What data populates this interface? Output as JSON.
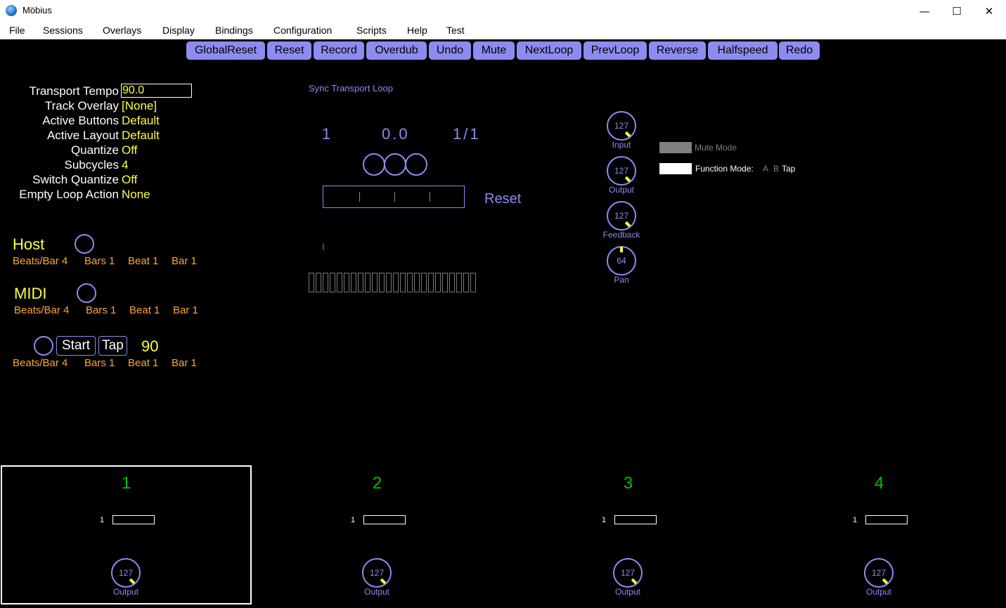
{
  "window": {
    "title": "Möbius",
    "minimize": "—",
    "maximize": "☐",
    "close": "✕"
  },
  "menu": [
    "File",
    "Sessions",
    "Overlays",
    "Display",
    "Bindings",
    "Configuration",
    "Scripts",
    "Help",
    "Test"
  ],
  "buttons": [
    "GlobalReset",
    "Reset",
    "Record",
    "Overdub",
    "Undo",
    "Mute",
    "NextLoop",
    "PrevLoop",
    "Reverse",
    "Halfspeed",
    "Redo"
  ],
  "params": {
    "tempo_label": "Transport Tempo",
    "tempo_value": "90.0",
    "items": [
      {
        "label": "Track Overlay",
        "value": "[None]"
      },
      {
        "label": "Active Buttons",
        "value": "Default"
      },
      {
        "label": "Active Layout",
        "value": "Default"
      },
      {
        "label": "Quantize",
        "value": "Off"
      },
      {
        "label": "Subcycles",
        "value": "4"
      },
      {
        "label": "Switch Quantize",
        "value": "Off"
      },
      {
        "label": "Empty Loop Action",
        "value": "None"
      }
    ]
  },
  "sync": {
    "host": {
      "title": "Host",
      "beats_per_bar": "Beats/Bar 4",
      "bars": "Bars 1",
      "beat": "Beat 1",
      "bar": "Bar 1"
    },
    "midi": {
      "title": "MIDI",
      "beats_per_bar": "Beats/Bar 4",
      "bars": "Bars 1",
      "beat": "Beat 1",
      "bar": "Bar 1"
    },
    "transport": {
      "start": "Start",
      "tap": "Tap",
      "tempo": "90",
      "beats_per_bar": "Beats/Bar 4",
      "bars": "Bars 1",
      "beat": "Beat 1",
      "bar": "Bar 1"
    }
  },
  "loop": {
    "sync_label": "Sync Transport Loop",
    "loop_number": "1",
    "position": "0.0",
    "loop_count": "1/1",
    "mode": "Reset",
    "level_marker": "I"
  },
  "knobs": [
    {
      "value": "127",
      "label": "Input"
    },
    {
      "value": "127",
      "label": "Output"
    },
    {
      "value": "127",
      "label": "Feedback"
    },
    {
      "value": "64",
      "label": "Pan"
    }
  ],
  "modes": {
    "mute": "Mute Mode",
    "function_label": "Function Mode:",
    "function_a": "A",
    "function_b": "B",
    "function_tap": "Tap"
  },
  "tracks": [
    {
      "number": "1",
      "loop": "1",
      "knob_value": "127",
      "knob_label": "Output"
    },
    {
      "number": "2",
      "loop": "1",
      "knob_value": "127",
      "knob_label": "Output"
    },
    {
      "number": "3",
      "loop": "1",
      "knob_value": "127",
      "knob_label": "Output"
    },
    {
      "number": "4",
      "loop": "1",
      "knob_value": "127",
      "knob_label": "Output"
    }
  ],
  "colors": {
    "accent": "#8c8cf0",
    "value": "#ffff3c",
    "sync_info": "#ffa533",
    "track_number": "#00c000"
  }
}
